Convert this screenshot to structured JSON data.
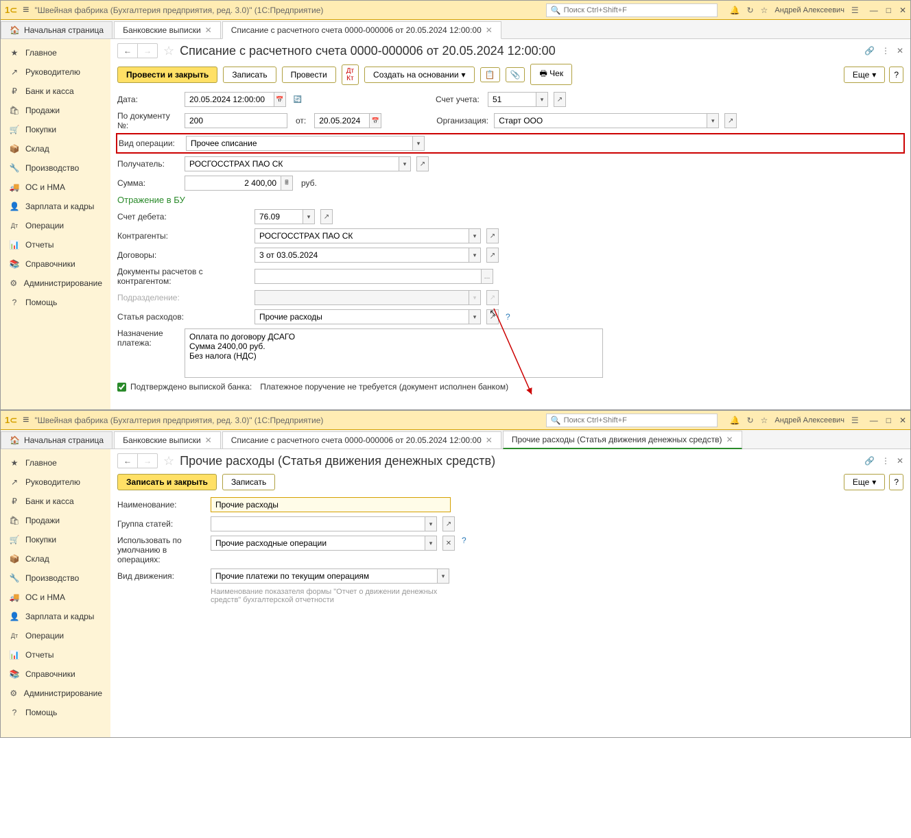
{
  "app": {
    "title": "\"Швейная фабрика (Бухгалтерия предприятия, ред. 3.0)\"  (1С:Предприятие)",
    "search_placeholder": "Поиск Ctrl+Shift+F",
    "user": "Андрей Алексеевич"
  },
  "sidebar": [
    {
      "icon": "★",
      "label": "Главное"
    },
    {
      "icon": "↗",
      "label": "Руководителю"
    },
    {
      "icon": "₽",
      "label": "Банк и касса"
    },
    {
      "icon": "🛍",
      "label": "Продажи"
    },
    {
      "icon": "🛒",
      "label": "Покупки"
    },
    {
      "icon": "📦",
      "label": "Склад"
    },
    {
      "icon": "🔧",
      "label": "Производство"
    },
    {
      "icon": "🚚",
      "label": "ОС и НМА"
    },
    {
      "icon": "👤",
      "label": "Зарплата и кадры"
    },
    {
      "icon": "Дт",
      "label": "Операции"
    },
    {
      "icon": "📊",
      "label": "Отчеты"
    },
    {
      "icon": "📚",
      "label": "Справочники"
    },
    {
      "icon": "⚙",
      "label": "Администрирование"
    },
    {
      "icon": "?",
      "label": "Помощь"
    }
  ],
  "tabs_top": {
    "home": "Начальная страница",
    "t1": "Банковские выписки",
    "t2": "Списание с расчетного счета 0000-000006 от 20.05.2024 12:00:00"
  },
  "doc1": {
    "title": "Списание с расчетного счета 0000-000006 от 20.05.2024 12:00:00",
    "btn_post_close": "Провести и закрыть",
    "btn_save": "Записать",
    "btn_post": "Провести",
    "btn_create_based": "Создать на основании",
    "btn_check": "Чек",
    "btn_more": "Еще",
    "lbl_date": "Дата:",
    "val_date": "20.05.2024 12:00:00",
    "lbl_account": "Счет учета:",
    "val_account": "51",
    "lbl_docnum": "По документу №:",
    "val_docnum": "200",
    "lbl_from": "от:",
    "val_from": "20.05.2024",
    "lbl_org": "Организация:",
    "val_org": "Старт ООО",
    "lbl_optype": "Вид операции:",
    "val_optype": "Прочее списание",
    "lbl_recipient": "Получатель:",
    "val_recipient": "РОСГОССТРАХ ПАО СК",
    "lbl_sum": "Сумма:",
    "val_sum": "2 400,00",
    "currency": "руб.",
    "section_bu": "Отражение в БУ",
    "lbl_debit": "Счет дебета:",
    "val_debit": "76.09",
    "lbl_contragent": "Контрагенты:",
    "val_contragent": "РОСГОССТРАХ ПАО СК",
    "lbl_contract": "Договоры:",
    "val_contract": "3 от 03.05.2024",
    "lbl_settlement": "Документы расчетов с контрагентом:",
    "lbl_division": "Подразделение:",
    "lbl_expense": "Статья расходов:",
    "val_expense": "Прочие расходы",
    "lbl_purpose": "Назначение платежа:",
    "val_purpose": "Оплата по договору ДСАГО\nСумма 2400,00 руб.\nБез налога (НДС)",
    "chk_confirmed": "Подтверждено выпиской банка:",
    "txt_payment": "Платежное поручение не требуется (документ исполнен банком)"
  },
  "tabs_bottom": {
    "home": "Начальная страница",
    "t1": "Банковские выписки",
    "t2": "Списание с расчетного счета 0000-000006 от 20.05.2024 12:00:00",
    "t3": "Прочие расходы (Статья движения денежных средств)"
  },
  "doc2": {
    "title": "Прочие расходы (Статья движения денежных средств)",
    "btn_save_close": "Записать и закрыть",
    "btn_save": "Записать",
    "btn_more": "Еще",
    "lbl_name": "Наименование:",
    "val_name": "Прочие расходы",
    "lbl_group": "Группа статей:",
    "lbl_default": "Использовать по умолчанию в операциях:",
    "val_default": "Прочие расходные операции",
    "lbl_movement": "Вид движения:",
    "val_movement": "Прочие платежи по текущим операциям",
    "note": "Наименование показателя формы \"Отчет о движении денежных средств\" бухгалтерской отчетности"
  }
}
